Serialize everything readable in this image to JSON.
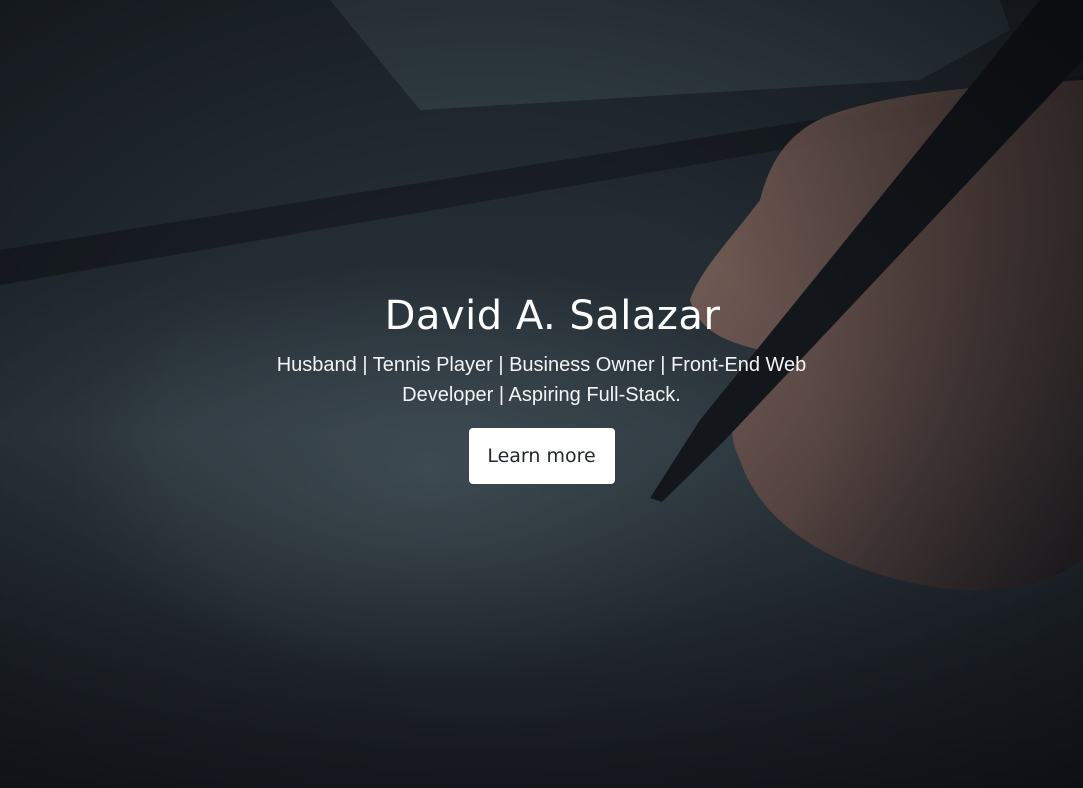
{
  "hero": {
    "title": "David A. Salazar",
    "subtitle": "Husband | Tennis Player | Business Owner | Front-End Web Developer | Aspiring Full-Stack.",
    "button_label": "Learn more",
    "background_image": "hand-writing-with-stylus-photo"
  },
  "colors": {
    "text": "#ffffff",
    "button_bg": "#ffffff",
    "button_text": "#24292d",
    "overlay": "#1b1f26"
  }
}
